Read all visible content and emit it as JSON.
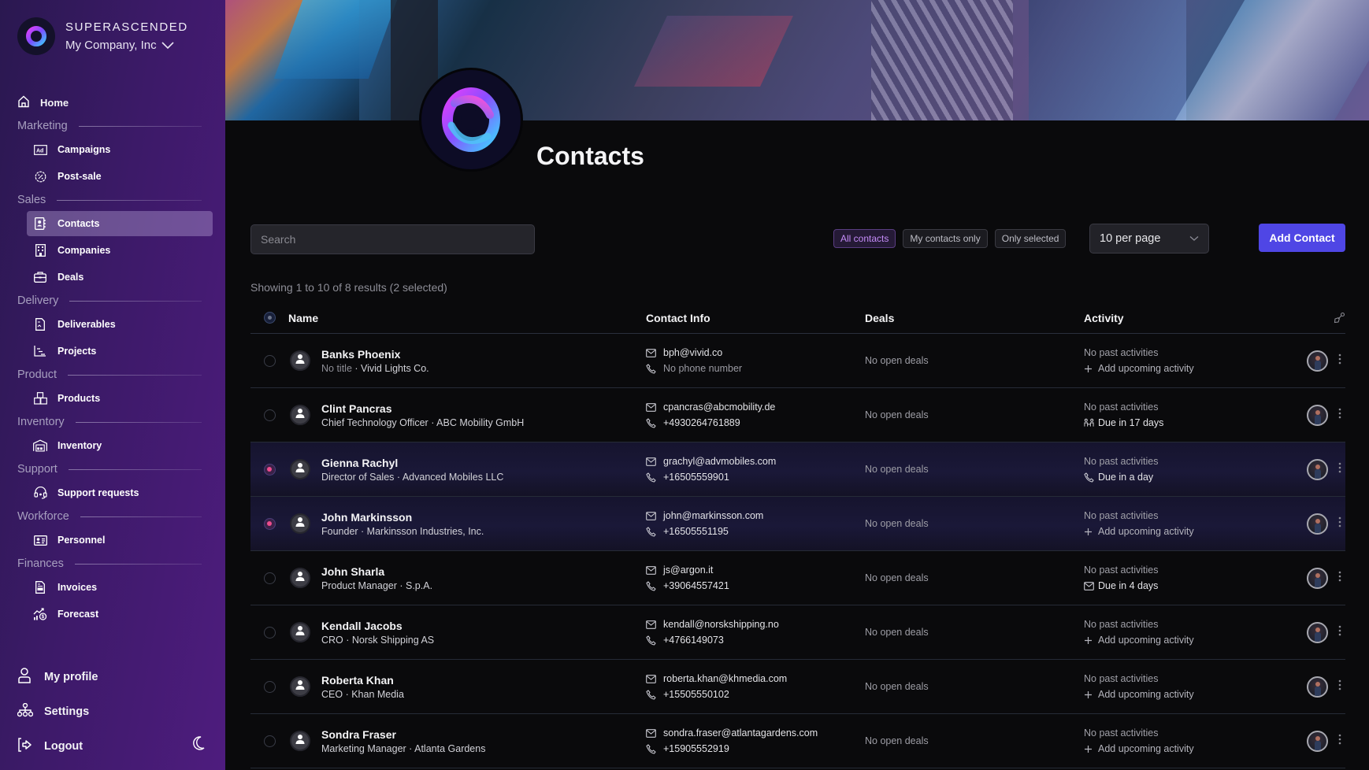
{
  "brand": {
    "name": "SUPERASCENDED",
    "company": "My Company, Inc"
  },
  "nav": {
    "home": "Home",
    "sections": [
      {
        "label": "Marketing",
        "items": [
          {
            "label": "Campaigns",
            "icon": "ad-icon"
          },
          {
            "label": "Post-sale",
            "icon": "discount-icon"
          }
        ]
      },
      {
        "label": "Sales",
        "items": [
          {
            "label": "Contacts",
            "icon": "contact-book-icon",
            "active": true
          },
          {
            "label": "Companies",
            "icon": "building-icon"
          },
          {
            "label": "Deals",
            "icon": "briefcase-icon"
          }
        ]
      },
      {
        "label": "Delivery",
        "items": [
          {
            "label": "Deliverables",
            "icon": "document-icon"
          },
          {
            "label": "Projects",
            "icon": "gantt-icon"
          }
        ]
      },
      {
        "label": "Product",
        "items": [
          {
            "label": "Products",
            "icon": "boxes-icon"
          }
        ]
      },
      {
        "label": "Inventory",
        "items": [
          {
            "label": "Inventory",
            "icon": "warehouse-icon"
          }
        ]
      },
      {
        "label": "Support",
        "items": [
          {
            "label": "Support requests",
            "icon": "headset-icon"
          }
        ]
      },
      {
        "label": "Workforce",
        "items": [
          {
            "label": "Personnel",
            "icon": "id-card-icon"
          }
        ]
      },
      {
        "label": "Finances",
        "items": [
          {
            "label": "Invoices",
            "icon": "invoice-icon"
          },
          {
            "label": "Forecast",
            "icon": "chart-dollar-icon"
          }
        ]
      }
    ],
    "bottom": {
      "profile": "My profile",
      "settings": "Settings",
      "logout": "Logout"
    }
  },
  "page": {
    "title": "Contacts"
  },
  "toolbar": {
    "search_placeholder": "Search",
    "search_value": "",
    "filters": [
      {
        "label": "All contacts",
        "active": true
      },
      {
        "label": "My contacts only",
        "active": false
      },
      {
        "label": "Only selected",
        "active": false
      }
    ],
    "per_page": "10 per page",
    "add_label": "Add Contact"
  },
  "summary": "Showing 1 to 10 of 8 results (2 selected)",
  "table": {
    "headers": {
      "name": "Name",
      "contact": "Contact Info",
      "deals": "Deals",
      "activity": "Activity"
    },
    "rows": [
      {
        "name": "Banks Phoenix",
        "title": "No title",
        "title_muted": true,
        "company": "Vivid Lights Co.",
        "email": "bph@vivid.co",
        "phone": "No phone number",
        "phone_muted": true,
        "deals": "No open deals",
        "past": "No past activities",
        "upcoming": "Add upcoming activity",
        "upcoming_icon": "plus-icon",
        "selected": false
      },
      {
        "name": "Clint Pancras",
        "title": "Chief Technology Officer",
        "company": "ABC Mobility GmbH",
        "email": "cpancras@abcmobility.de",
        "phone": "+4930264761889",
        "deals": "No open deals",
        "past": "No past activities",
        "upcoming": "Due in 17 days",
        "upcoming_icon": "meeting-icon",
        "selected": false
      },
      {
        "name": "Gienna Rachyl",
        "title": "Director of Sales",
        "company": "Advanced Mobiles LLC",
        "email": "grachyl@advmobiles.com",
        "phone": "+16505559901",
        "deals": "No open deals",
        "past": "No past activities",
        "upcoming": "Due in a day",
        "upcoming_icon": "phone-icon",
        "selected": true
      },
      {
        "name": "John Markinsson",
        "title": "Founder",
        "company": "Markinsson Industries, Inc.",
        "email": "john@markinsson.com",
        "phone": "+16505551195",
        "deals": "No open deals",
        "past": "No past activities",
        "upcoming": "Add upcoming activity",
        "upcoming_icon": "plus-icon",
        "selected": true
      },
      {
        "name": "John Sharla",
        "title": "Product Manager",
        "company": "S.p.A.",
        "email": "js@argon.it",
        "phone": "+39064557421",
        "deals": "No open deals",
        "past": "No past activities",
        "upcoming": "Due in 4 days",
        "upcoming_icon": "mail-icon",
        "selected": false
      },
      {
        "name": "Kendall Jacobs",
        "title": "CRO",
        "company": "Norsk Shipping AS",
        "email": "kendall@norskshipping.no",
        "phone": "+4766149073",
        "deals": "No open deals",
        "past": "No past activities",
        "upcoming": "Add upcoming activity",
        "upcoming_icon": "plus-icon",
        "selected": false
      },
      {
        "name": "Roberta Khan",
        "title": "CEO",
        "company": "Khan Media",
        "email": "roberta.khan@khmedia.com",
        "phone": "+15505550102",
        "deals": "No open deals",
        "past": "No past activities",
        "upcoming": "Add upcoming activity",
        "upcoming_icon": "plus-icon",
        "selected": false
      },
      {
        "name": "Sondra Fraser",
        "title": "Marketing Manager",
        "company": "Atlanta Gardens",
        "email": "sondra.fraser@atlantagardens.com",
        "phone": "+15905552919",
        "deals": "No open deals",
        "past": "No past activities",
        "upcoming": "Add upcoming activity",
        "upcoming_icon": "plus-icon",
        "selected": false
      }
    ]
  },
  "colors": {
    "accent": "#4f46e5",
    "selected_dot": "#ec4d8e",
    "active_filter": "#c58cf8",
    "sidebar_start": "#2a1850",
    "sidebar_end": "#4e1c7e"
  }
}
